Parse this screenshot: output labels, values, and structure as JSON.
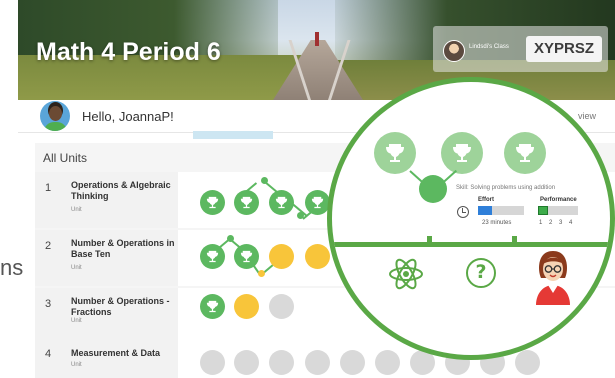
{
  "header": {
    "course_title": "Math 4 Period 6",
    "class_label": "Lindsdi's Class",
    "class_code": "XYPRSZ"
  },
  "greeting_bar": {
    "greeting": "Hello, JoannaP!",
    "view_link": "view"
  },
  "units": {
    "header": "All Units",
    "items": [
      {
        "number": "1",
        "name": "Operations & Algebraic Thinking",
        "type": "Unit"
      },
      {
        "number": "2",
        "name": "Number & Operations in Base Ten",
        "type": "Unit"
      },
      {
        "number": "3",
        "name": "Number & Operations - Fractions",
        "type": "Unit"
      },
      {
        "number": "4",
        "name": "Measurement & Data",
        "type": "Unit"
      }
    ]
  },
  "left_fragment": "ns",
  "detail": {
    "skill": "Skill: Solving problems using addition",
    "effort_label": "Effort",
    "effort_value": "23 minutes",
    "effort_fraction": 0.3,
    "performance_label": "Performance",
    "performance_scale": [
      "1",
      "2",
      "3",
      "4"
    ],
    "performance_level": 1
  },
  "icons": {
    "atom": "atom-icon",
    "help": "question-mark-icon",
    "avatar": "teacher-avatar-icon",
    "trophy": "trophy-icon"
  },
  "colors": {
    "accent_green": "#5aa846",
    "trophy_green": "#5cb860",
    "progress_yellow": "#f8c53a",
    "empty_gray": "#d9d9d9",
    "effort_blue": "#2f7fd9"
  }
}
